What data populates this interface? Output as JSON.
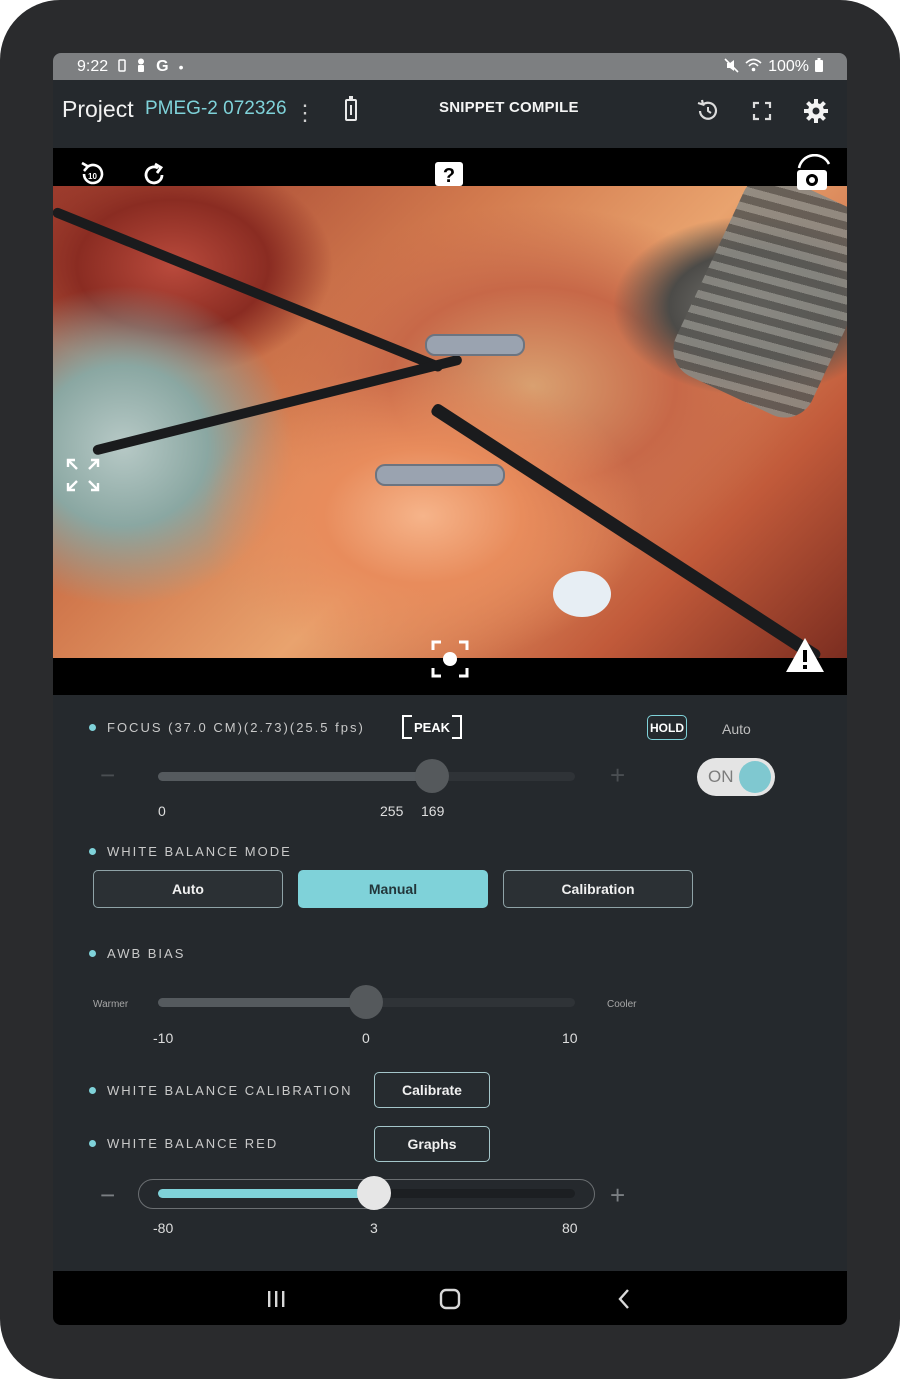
{
  "status_bar": {
    "time": "9:22",
    "left_icons": [
      "sim-icon",
      "person-icon",
      "google-icon",
      "dot-icon"
    ],
    "battery_percent": "100%",
    "right_icons": [
      "mute-icon",
      "wifi-icon",
      "battery-icon"
    ]
  },
  "header": {
    "project_label": "Project",
    "project_name": "PMEG-2 072326",
    "title": "SNIPPET COMPILE"
  },
  "video": {
    "overlay_icons": [
      "replay-10-icon",
      "refresh-icon",
      "help-icon",
      "camera-switch-icon",
      "expand-icon",
      "focus-target-icon",
      "warning-icon"
    ]
  },
  "focus": {
    "label": "FOCUS (37.0 CM)(2.73)(25.5 fps)",
    "peak_label": "PEAK",
    "hold_label": "HOLD",
    "auto_label": "Auto",
    "toggle_label": "ON",
    "toggle_on": true,
    "min_label": "0",
    "max_label": "255",
    "value_label": "169",
    "value": 169,
    "min": 0,
    "max": 255
  },
  "white_balance_mode": {
    "label": "WHITE BALANCE MODE",
    "options": [
      "Auto",
      "Manual",
      "Calibration"
    ],
    "selected": "Manual"
  },
  "awb_bias": {
    "label": "AWB BIAS",
    "left_label": "Warmer",
    "right_label": "Cooler",
    "min_label": "-10",
    "value_label": "0",
    "max_label": "10",
    "value": 0
  },
  "wb_calibration": {
    "label": "WHITE BALANCE CALIBRATION",
    "button": "Calibrate"
  },
  "wb_red": {
    "label": "WHITE BALANCE RED",
    "button": "Graphs",
    "min_label": "-80",
    "value_label": "3",
    "max_label": "80",
    "value": 3
  },
  "colors": {
    "accent": "#7fd2d9",
    "background": "#25292d",
    "frame": "#2a2b2d"
  }
}
